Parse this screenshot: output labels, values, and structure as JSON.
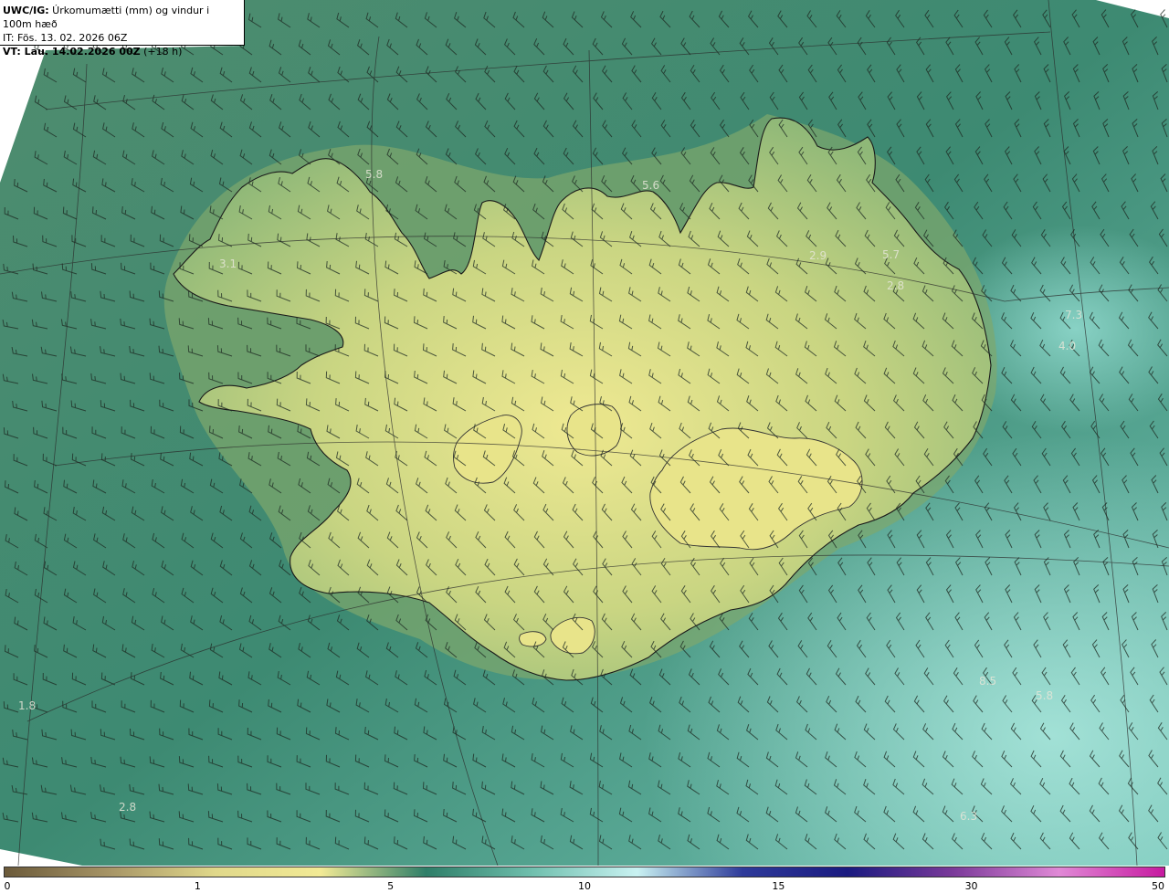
{
  "header": {
    "title_bold": "UWC/IG:",
    "title_rest": " Úrkomumætti (mm) og vindur i 100m hæð",
    "issue_time": "IT: Fös. 13. 02. 2026 06Z",
    "valid_prefix": "VT: Lau. 14.02.2026 00Z",
    "valid_suffix": " (+18 h)"
  },
  "colorbar": {
    "ticks": [
      "0",
      "1",
      "5",
      "10",
      "15",
      "30",
      "50"
    ],
    "tick_positions_pct": [
      0,
      16.7,
      33.3,
      50,
      66.7,
      83.3,
      100
    ],
    "colors": [
      "#6b5a3a",
      "#a79566",
      "#e0d88a",
      "#f2ea95",
      "#2e7e68",
      "#6fbfad",
      "#c9f2f2",
      "#2e3a9a",
      "#1a1a80",
      "#7b3a9a",
      "#e089d6",
      "#c71aa0"
    ]
  },
  "map": {
    "colors": {
      "land_bright": "#e6e48a",
      "land_mid": "#b7cc7e",
      "sea": "#3f8a70",
      "sea_light": "#7cc8b6",
      "coast": "#1a1a1a",
      "grid": "#2a2a2a"
    },
    "values": [
      {
        "label": "5.8"
      },
      {
        "label": "5.6"
      },
      {
        "label": "3.1"
      },
      {
        "label": "2.9"
      },
      {
        "label": "5.7"
      },
      {
        "label": "2.8"
      },
      {
        "label": "7.3"
      },
      {
        "label": "4.0"
      },
      {
        "label": "5.8"
      },
      {
        "label": "6.3"
      },
      {
        "label": "8.5"
      },
      {
        "label": "2.8"
      },
      {
        "label": "1.8"
      }
    ]
  }
}
